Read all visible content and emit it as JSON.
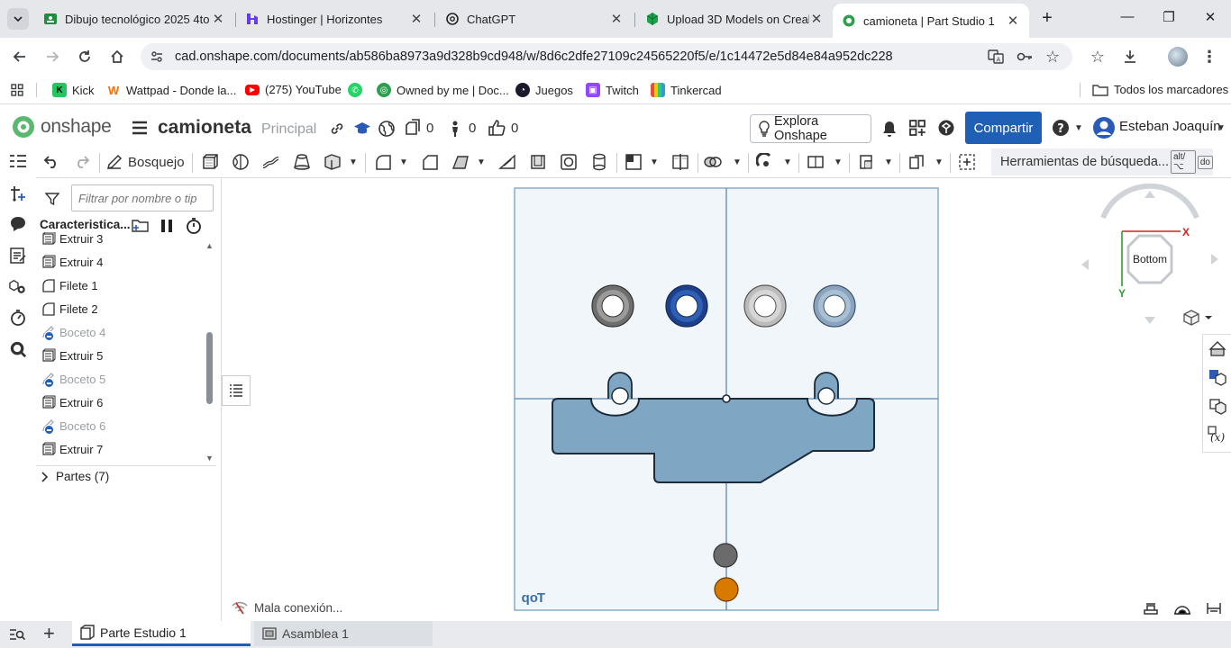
{
  "browser": {
    "tabs": [
      {
        "title": "Dibujo tecnológico 2025 4to",
        "icon": "google-classroom-icon",
        "color": "#1e8e3e"
      },
      {
        "title": "Hostinger | Horizontes",
        "icon": "hostinger-icon",
        "color": "#673de6"
      },
      {
        "title": "ChatGPT",
        "icon": "openai-icon",
        "color": "#222222"
      },
      {
        "title": "Upload 3D Models on Creali",
        "icon": "creality-icon",
        "color": "#1aa34a"
      },
      {
        "title": "camioneta | Part Studio 1",
        "icon": "onshape-icon",
        "color": "#2e9e4f"
      }
    ],
    "url": "cad.onshape.com/documents/ab586ba8973a9d328b9cd948/w/8d6c2dfe27109c24565220f5/e/1c14472e5d84e84a952dc228",
    "bookmarks": [
      {
        "label": "Kick",
        "icon": "kick-icon",
        "color": "#22c55e",
        "glyph": "K"
      },
      {
        "label": "Wattpad - Donde la...",
        "icon": "wattpad-icon",
        "color": "#ff6d00",
        "glyph": "W"
      },
      {
        "label": "(275) YouTube",
        "icon": "youtube-icon",
        "color": "#ff0000",
        "glyph": "▶"
      },
      {
        "label": "",
        "icon": "whatsapp-icon",
        "color": "#25d366",
        "glyph": "✆"
      },
      {
        "label": "Owned by me | Doc...",
        "icon": "onshape-icon",
        "color": "#2e9e4f",
        "glyph": "◎"
      },
      {
        "label": "Juegos",
        "icon": "gauge-icon",
        "color": "#1a1a2e",
        "glyph": "◔"
      },
      {
        "label": "Twitch",
        "icon": "twitch-icon",
        "color": "#9146ff",
        "glyph": "▣"
      },
      {
        "label": "Tinkercad",
        "icon": "tinkercad-icon",
        "color": "#f1a21b",
        "glyph": "▦"
      }
    ],
    "all_bookmarks": "Todos los marcadores"
  },
  "onshape": {
    "brand": "onshape",
    "doc_title": "camioneta",
    "branch": "Principal",
    "counts": {
      "versions": "0",
      "follows": "0",
      "likes": "0"
    },
    "explore": "Explora Onshape",
    "share": "Compartir",
    "user": "Esteban Joaquín",
    "sketch_label": "Bosquejo",
    "search_tools": "Herramientas de búsqueda...",
    "shortcut_key1": "alt/⌥",
    "shortcut_key2": "do"
  },
  "feature_panel": {
    "filter_placeholder": "Filtrar por nombre o tip",
    "header": "Caracteristica...",
    "partial_item": "Extruir 3",
    "items": [
      {
        "label": "Extruir 4",
        "type": "extrude",
        "suppressed": false
      },
      {
        "label": "Filete 1",
        "type": "fillet",
        "suppressed": false
      },
      {
        "label": "Filete 2",
        "type": "fillet",
        "suppressed": false
      },
      {
        "label": "Boceto 4",
        "type": "sketch",
        "suppressed": true
      },
      {
        "label": "Extruir 5",
        "type": "extrude",
        "suppressed": false
      },
      {
        "label": "Boceto 5",
        "type": "sketch",
        "suppressed": true
      },
      {
        "label": "Extruir 6",
        "type": "extrude",
        "suppressed": false
      },
      {
        "label": "Boceto 6",
        "type": "sketch",
        "suppressed": true
      },
      {
        "label": "Extruir 7",
        "type": "extrude",
        "suppressed": false
      }
    ],
    "parts": "Partes (7)"
  },
  "viewport": {
    "plane_label": "Top",
    "view_cube_face": "Bottom",
    "axis_x": "X",
    "axis_y": "Y",
    "status": "Mala conexión...",
    "colors": {
      "part_fill": "#7fa7c4",
      "ring_dark": "#555555",
      "ring_blue": "#1e3f8c",
      "ring_light": "#bbbbbb",
      "ring_steel": "#8aa4bd",
      "dot_gray": "#6b6b6b",
      "dot_orange": "#d97a00"
    }
  },
  "bottom_tabs": [
    {
      "label": "Parte Estudio 1",
      "active": true
    },
    {
      "label": "Asamblea 1",
      "active": false
    }
  ]
}
